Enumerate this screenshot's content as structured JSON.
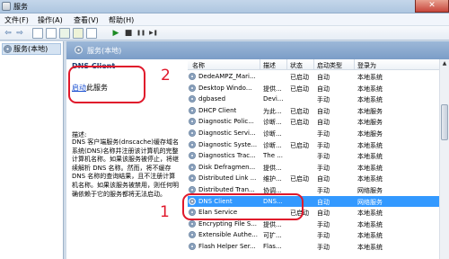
{
  "window": {
    "title": "服务",
    "close_glyph": "✕"
  },
  "menu": {
    "items": [
      "文件(F)",
      "操作(A)",
      "查看(V)",
      "帮助(H)"
    ]
  },
  "toolbar": {
    "buttons": [
      "back-icon",
      "forward-icon",
      "show-hide-tree-icon",
      "properties-icon",
      "refresh-icon",
      "export-icon",
      "help-icon",
      "start-icon",
      "stop-icon",
      "pause-icon",
      "resume-icon"
    ],
    "glyphs": {
      "back": "⇦",
      "forward": "⇨",
      "play": "▶",
      "stop": "■",
      "pause": "❚❚",
      "resume": "▶❚"
    }
  },
  "tree": {
    "root_label": "服务(本地)"
  },
  "pane": {
    "title": "服务(本地)"
  },
  "details": {
    "service_name": "DNS Client",
    "start_link": "启动",
    "start_suffix": "此服务",
    "desc_label": "描述:",
    "desc_text": "DNS 客户端服务(dnscache)缓存域名系统(DNS)名称并注册该计算机的完整计算机名称。如果该服务被停止，将继续解析 DNS 名称。然而，将不缓存 DNS 名称的查询结果，且不注册计算机名称。如果该服务被禁用，则任何明确依赖于它的服务都将无法启动。"
  },
  "list": {
    "columns": [
      "名称",
      "描述",
      "状态",
      "启动类型",
      "登录为"
    ],
    "rows": [
      {
        "name": "DedeAMPZ_Mari...",
        "desc": "",
        "status": "已启动",
        "startup": "自动",
        "logon": "本地系统"
      },
      {
        "name": "Desktop Windo...",
        "desc": "提供...",
        "status": "已启动",
        "startup": "自动",
        "logon": "本地系统"
      },
      {
        "name": "dgbased",
        "desc": "Devi...",
        "status": "",
        "startup": "手动",
        "logon": "本地系统"
      },
      {
        "name": "DHCP Client",
        "desc": "为此...",
        "status": "已启动",
        "startup": "自动",
        "logon": "本地服务"
      },
      {
        "name": "Diagnostic Polic...",
        "desc": "诊断...",
        "status": "已启动",
        "startup": "自动",
        "logon": "本地服务"
      },
      {
        "name": "Diagnostic Servi...",
        "desc": "诊断...",
        "status": "",
        "startup": "手动",
        "logon": "本地服务"
      },
      {
        "name": "Diagnostic Syste...",
        "desc": "诊断...",
        "status": "已启动",
        "startup": "手动",
        "logon": "本地系统"
      },
      {
        "name": "Diagnostics Trac...",
        "desc": "The ...",
        "status": "",
        "startup": "手动",
        "logon": "本地系统"
      },
      {
        "name": "Disk Defragmen...",
        "desc": "提供...",
        "status": "",
        "startup": "手动",
        "logon": "本地系统"
      },
      {
        "name": "Distributed Link ...",
        "desc": "维护...",
        "status": "已启动",
        "startup": "自动",
        "logon": "本地系统"
      },
      {
        "name": "Distributed Tran...",
        "desc": "协调...",
        "status": "",
        "startup": "手动",
        "logon": "网络服务"
      },
      {
        "name": "DNS Client",
        "desc": "DNS...",
        "status": "",
        "startup": "自动",
        "logon": "网络服务"
      },
      {
        "name": "Elan Service",
        "desc": "",
        "status": "已启动",
        "startup": "自动",
        "logon": "本地系统"
      },
      {
        "name": "Encrypting File S...",
        "desc": "提供...",
        "status": "",
        "startup": "手动",
        "logon": "本地系统"
      },
      {
        "name": "Extensible Authe...",
        "desc": "可扩...",
        "status": "",
        "startup": "手动",
        "logon": "本地系统"
      },
      {
        "name": "Flash Helper Ser...",
        "desc": "Flas...",
        "status": "",
        "startup": "手动",
        "logon": "本地系统"
      }
    ],
    "selected_index": 11
  },
  "annotations": {
    "label_1": "1",
    "label_2": "2",
    "color": "#e0182b"
  },
  "colors": {
    "selection": "#3399ff",
    "link": "#1a4fd0",
    "header_blue": "#7b9dc7"
  }
}
